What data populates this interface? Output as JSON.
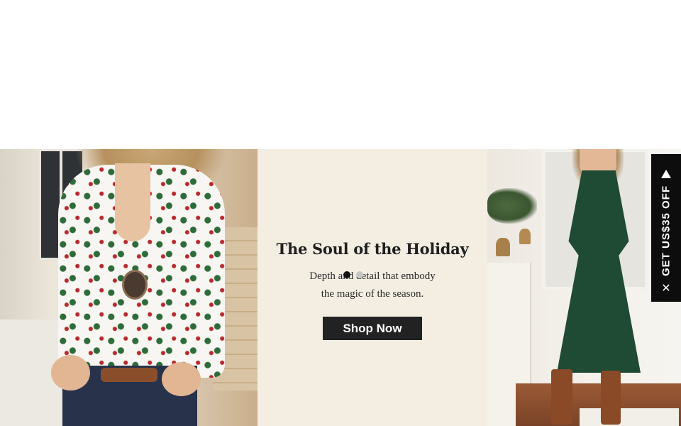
{
  "hero": {
    "headline": "The Soul of the Holiday",
    "subline_1": "Depth and detail that embody",
    "subline_2": "the magic of the season.",
    "cta_label": "Shop Now",
    "panel_color": "#f4ede2",
    "cta_color": "#222222"
  },
  "carousel": {
    "slide_count": 2,
    "active_index": 0,
    "active_dot_color": "#111111",
    "inactive_dot_color": "#c7c7c7"
  },
  "coupon_tab": {
    "label": "GET US$35 OFF",
    "expand_icon": "triangle-up-icon",
    "close_icon": "close-icon",
    "background": "#0d0d0d"
  },
  "images": {
    "left": "model-in-christmas-tree-print-blouse",
    "right": "model-in-dark-green-long-sleeve-dress"
  }
}
